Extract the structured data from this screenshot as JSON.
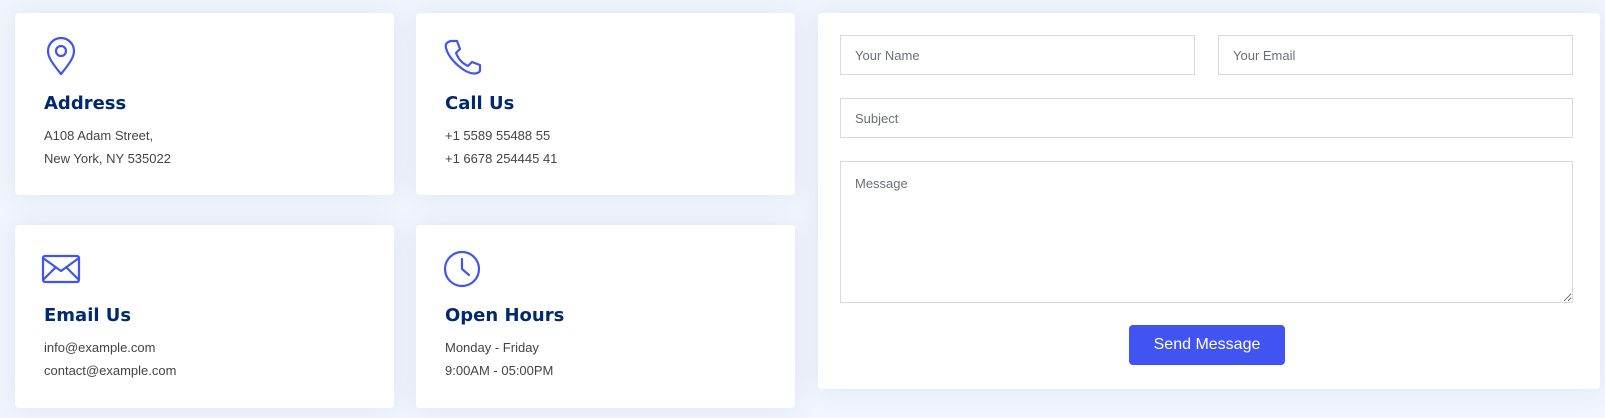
{
  "colors": {
    "accent": "#4154f1",
    "title": "#012970",
    "text": "#444444",
    "background": "#f1f5fd"
  },
  "info_cards": [
    {
      "icon": "geo-alt-icon",
      "title": "Address",
      "lines": [
        "A108 Adam Street,",
        "New York, NY 535022"
      ]
    },
    {
      "icon": "telephone-icon",
      "title": "Call Us",
      "lines": [
        "+1 5589 55488 55",
        "+1 6678 254445 41"
      ]
    },
    {
      "icon": "envelope-icon",
      "title": "Email Us",
      "lines": [
        "info@example.com",
        "contact@example.com"
      ]
    },
    {
      "icon": "clock-icon",
      "title": "Open Hours",
      "lines": [
        "Monday - Friday",
        "9:00AM - 05:00PM"
      ]
    }
  ],
  "form": {
    "name_placeholder": "Your Name",
    "email_placeholder": "Your Email",
    "subject_placeholder": "Subject",
    "message_placeholder": "Message",
    "submit_label": "Send Message"
  }
}
